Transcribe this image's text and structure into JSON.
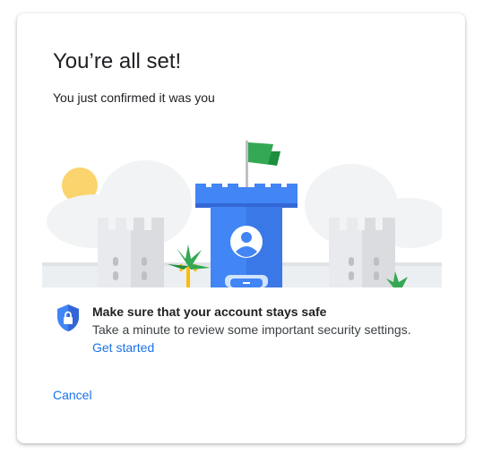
{
  "dialog": {
    "title": "You’re all set!",
    "subtitle": "You just confirmed it was you"
  },
  "security_notice": {
    "icon": "shield-lock-icon",
    "heading": "Make sure that your account stays safe",
    "body": "Take a minute to review some important security settings.",
    "link_label": "Get started"
  },
  "actions": {
    "cancel_label": "Cancel"
  },
  "colors": {
    "accent": "#1a73e8",
    "tower_blue": "#4285f4",
    "flag_green": "#34a853",
    "sun_yellow": "#fbd46d"
  }
}
